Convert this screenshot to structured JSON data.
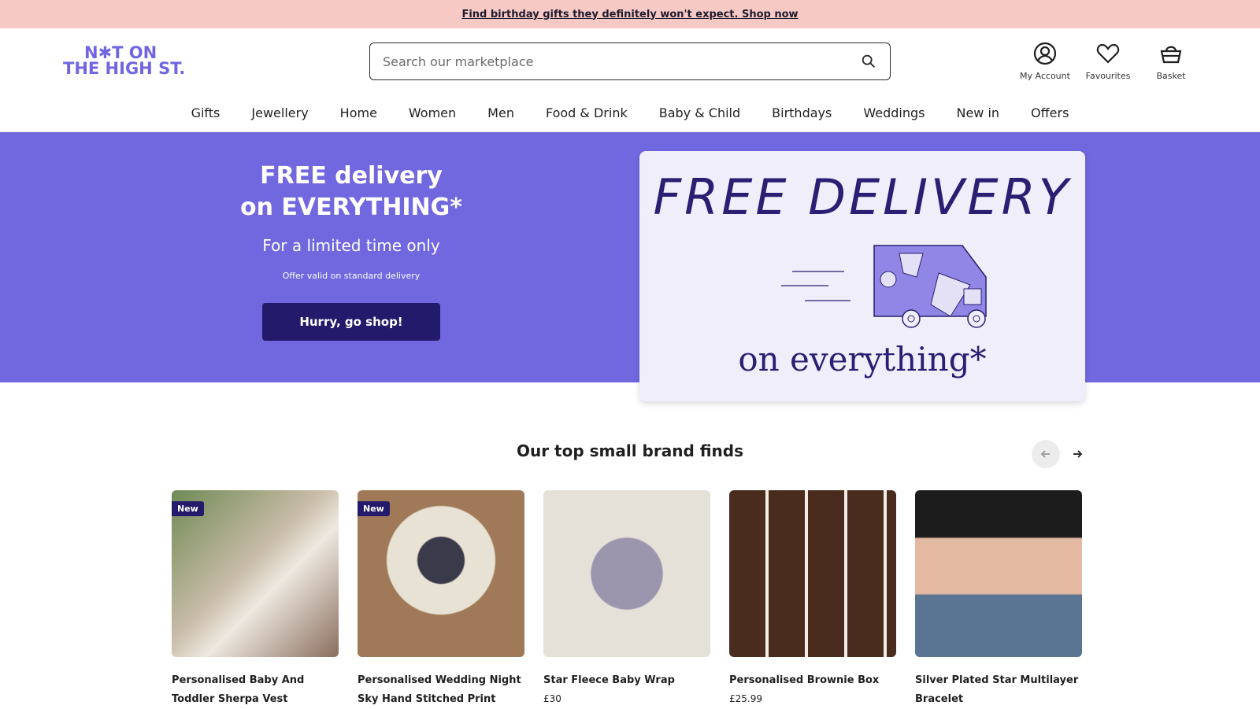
{
  "promo": {
    "text": "Find birthday gifts they definitely won't expect. Shop now"
  },
  "logo": {
    "line1": "N✱T ON",
    "line2": "THE HIGH ST."
  },
  "search": {
    "placeholder": "Search our marketplace"
  },
  "header_icons": [
    {
      "label": "My Account",
      "icon": "account-icon"
    },
    {
      "label": "Favourites",
      "icon": "heart-icon"
    },
    {
      "label": "Basket",
      "icon": "basket-icon"
    }
  ],
  "nav": [
    "Gifts",
    "Jewellery",
    "Home",
    "Women",
    "Men",
    "Food & Drink",
    "Baby & Child",
    "Birthdays",
    "Weddings",
    "New in",
    "Offers"
  ],
  "hero": {
    "title_line1": "FREE delivery",
    "title_line2": "on EVERYTHING*",
    "subtitle": "For a limited time only",
    "note": "Offer valid on standard delivery",
    "cta": "Hurry, go shop!",
    "card_title": "FREE DELIVERY",
    "card_bottom": "on everything*"
  },
  "section": {
    "title": "Our top small brand finds"
  },
  "products": [
    {
      "name": "Personalised Baby And Toddler Sherpa Vest",
      "price": "",
      "badge": "New",
      "bg": "#a89a86"
    },
    {
      "name": "Personalised Wedding Night Sky Hand Stitched Print",
      "price": "",
      "badge": "New",
      "bg": "#8a6e52"
    },
    {
      "name": "Star Fleece Baby Wrap",
      "price": "£30",
      "badge": "",
      "bg": "#d9d2c7"
    },
    {
      "name": "Personalised Brownie Box",
      "price": "£25.99",
      "badge": "",
      "bg": "#5b3a2a"
    },
    {
      "name": "Silver Plated Star Multilayer Bracelet",
      "price": "",
      "badge": "",
      "bg": "#4a5f7a"
    }
  ],
  "colors": {
    "promo_bg": "#f6c9c4",
    "brand": "#6f66e0",
    "hero_bg": "#7168e0",
    "cta_bg": "#241a6b"
  }
}
